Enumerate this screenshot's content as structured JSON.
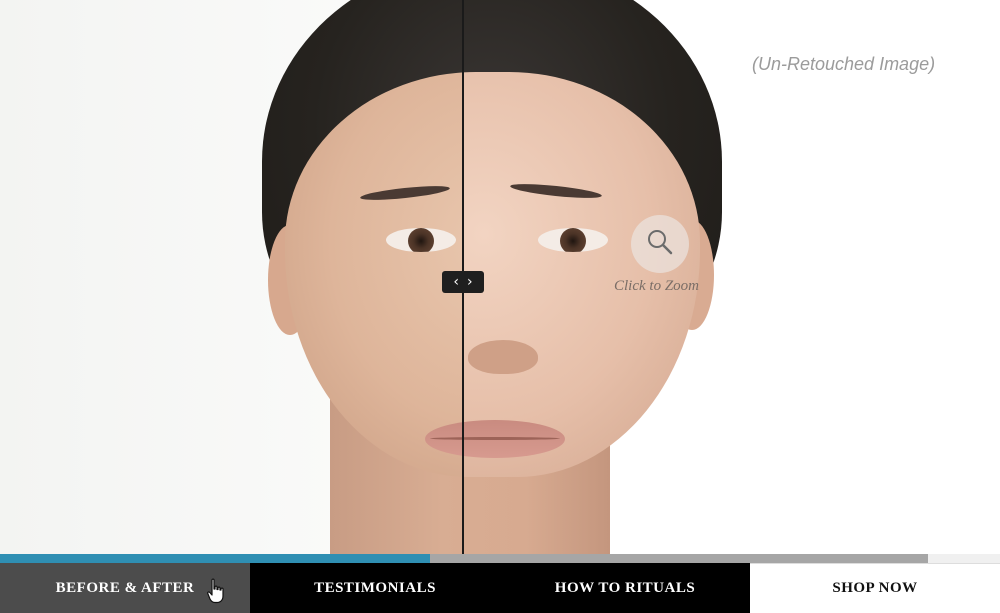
{
  "viewer": {
    "right_caption": "(Un-Retouched Image)",
    "zoom_label": "Click to Zoom",
    "slider_left_glyph": "‹",
    "slider_right_glyph": "›",
    "icons": {
      "zoom": "magnifier-icon",
      "slider": "chevron-left-right-icon",
      "cursor": "hand-pointer-icon"
    }
  },
  "progress": {
    "fraction": 0.43,
    "fill_color": "#2f8fb3",
    "track_color": "#a6a6a6"
  },
  "nav": {
    "items": [
      {
        "label": "BEFORE & AFTER",
        "state": "active"
      },
      {
        "label": "TESTIMONIALS",
        "state": "default"
      },
      {
        "label": "HOW TO RITUALS",
        "state": "default"
      },
      {
        "label": "SHOP NOW",
        "state": "default"
      }
    ]
  }
}
